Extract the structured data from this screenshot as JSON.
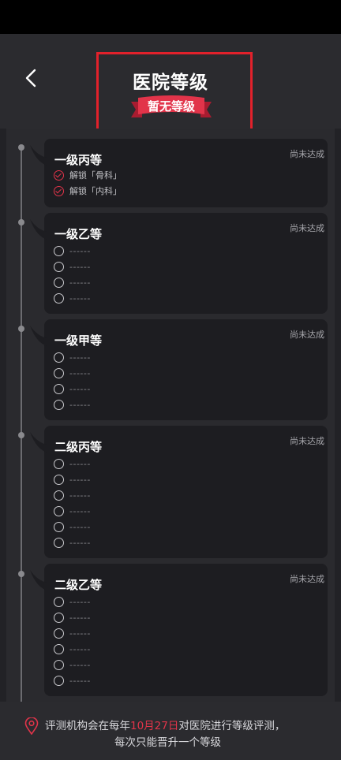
{
  "header": {
    "title": "医院等级",
    "badge": "暂无等级",
    "back_icon": "chevron-left-icon"
  },
  "colors": {
    "accent": "#e2344a",
    "background": "#222226",
    "card": "#1d1d21"
  },
  "levels": [
    {
      "title": "一级丙等",
      "status": "尚未达成",
      "items": [
        {
          "text": "解锁「骨科」",
          "done": true
        },
        {
          "text": "解锁「内科」",
          "done": true
        }
      ]
    },
    {
      "title": "一级乙等",
      "status": "尚未达成",
      "items": [
        {
          "text": "------",
          "done": false
        },
        {
          "text": "------",
          "done": false
        },
        {
          "text": "------",
          "done": false
        },
        {
          "text": "------",
          "done": false
        }
      ]
    },
    {
      "title": "一级甲等",
      "status": "尚未达成",
      "items": [
        {
          "text": "------",
          "done": false
        },
        {
          "text": "------",
          "done": false
        },
        {
          "text": "------",
          "done": false
        },
        {
          "text": "------",
          "done": false
        }
      ]
    },
    {
      "title": "二级丙等",
      "status": "尚未达成",
      "items": [
        {
          "text": "------",
          "done": false
        },
        {
          "text": "------",
          "done": false
        },
        {
          "text": "------",
          "done": false
        },
        {
          "text": "------",
          "done": false
        },
        {
          "text": "------",
          "done": false
        },
        {
          "text": "------",
          "done": false
        }
      ]
    },
    {
      "title": "二级乙等",
      "status": "尚未达成",
      "items": [
        {
          "text": "------",
          "done": false
        },
        {
          "text": "------",
          "done": false
        },
        {
          "text": "------",
          "done": false
        },
        {
          "text": "------",
          "done": false
        },
        {
          "text": "------",
          "done": false
        },
        {
          "text": "------",
          "done": false
        }
      ]
    }
  ],
  "footer": {
    "icon": "location-pin-icon",
    "line1_pre": "评测机构会在每年",
    "line1_date": "10月27日",
    "line1_post": "对医院进行等级评测，",
    "line2": "每次只能晋升一个等级"
  }
}
